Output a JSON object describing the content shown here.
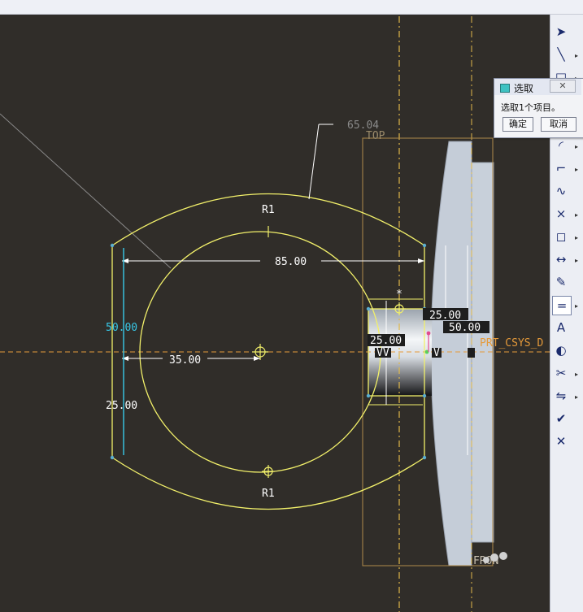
{
  "dialog": {
    "title": "选取",
    "close_label": "✕",
    "message": "选取1个项目。",
    "ok_label": "确定",
    "cancel_label": "取消"
  },
  "sketch": {
    "dim_top": "65.04",
    "dim_width": "85.00",
    "dim_height": "50.00",
    "dim_lower": "25.00",
    "dim_offset": "35.00",
    "dim_25_right": "25.00",
    "dim_50_right": "50.00",
    "dim_25_left": "25.00",
    "radius_top": "R1",
    "radius_bottom": "R1",
    "ref_top": "TOP",
    "csys_label": "PRT_CSYS_D",
    "front_label": "FRON",
    "constraint_v1": "VV",
    "constraint_v2": "V",
    "star_mark": "*"
  },
  "toolbar": {
    "tools": [
      "select-arrow-icon",
      "line-icon",
      "rectangle-icon",
      "circle-icon",
      "arc-icon",
      "fillet-icon",
      "spline-icon",
      "point-icon",
      "offset-icon",
      "dimension-icon",
      "modify-icon",
      "constraint-icon",
      "text-icon",
      "palette-icon",
      "trim-icon",
      "mirror-icon",
      "accept-icon",
      "cancel-icon"
    ]
  },
  "colors": {
    "background": "#302d29",
    "sketch": "#f2f06a",
    "dimension": "#ffffff",
    "selected_dimension": "#38c9e8",
    "datum": "#e59a3a",
    "part": "#c5cdd8"
  }
}
